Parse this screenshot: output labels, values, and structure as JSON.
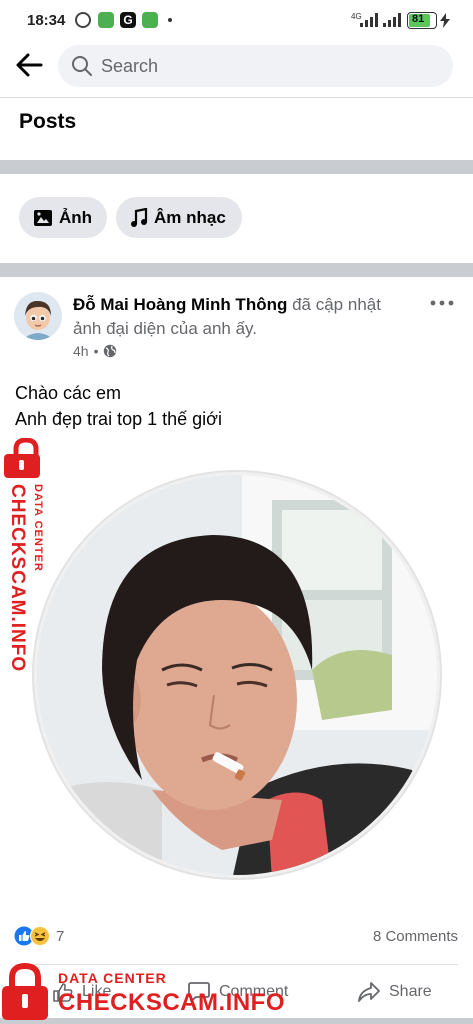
{
  "status_bar": {
    "time": "18:34",
    "battery": "81",
    "network": "4G"
  },
  "header": {
    "search_placeholder": "Search"
  },
  "section_title": "Posts",
  "filters": [
    {
      "label": "Ảnh",
      "icon": "photo-icon"
    },
    {
      "label": "Âm nhạc",
      "icon": "music-note-icon"
    }
  ],
  "post": {
    "author": "Đỗ Mai Hoàng Minh Thông",
    "action": "đã cập nhật ảnh đại diện của anh ấy.",
    "time": "4h",
    "privacy_icon": "globe-icon",
    "text_line1": "Chào các em",
    "text_line2": "Anh đẹp trai top 1 thế giới",
    "reaction_count": "7",
    "comments": "8 Comments",
    "like_label": "Like",
    "comment_label": "Comment",
    "share_label": "Share"
  },
  "watermark": {
    "top": "DATA CENTER",
    "bottom": "CHECKSCAM.INFO"
  },
  "colors": {
    "like_blue": "#1877f2",
    "watermark_red": "#e02020",
    "divider": "#c9ccd1"
  }
}
